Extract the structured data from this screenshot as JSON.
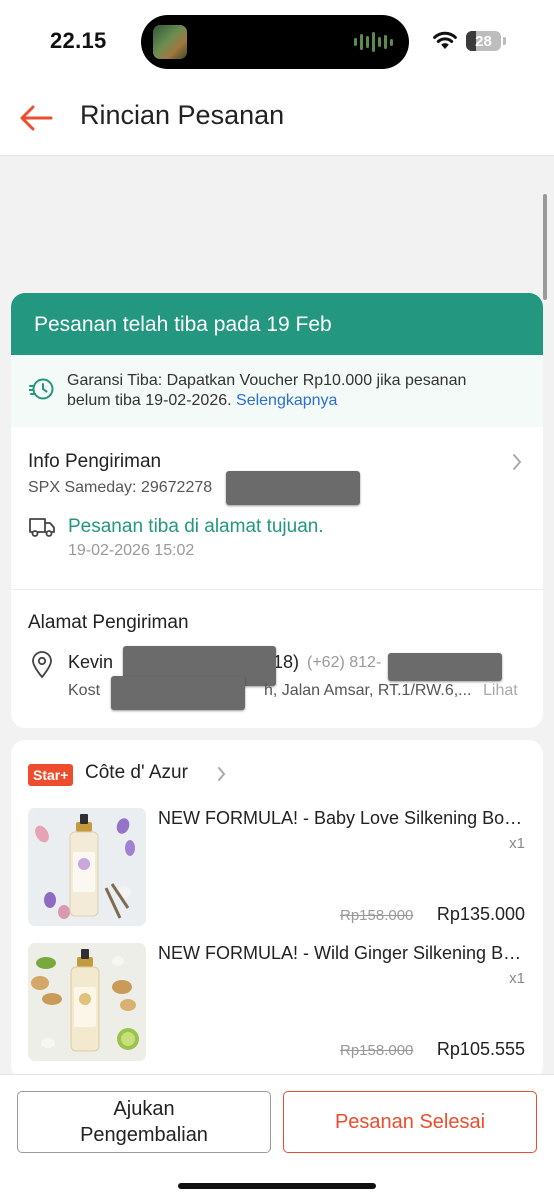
{
  "status_bar": {
    "time": "22.15",
    "battery": "28",
    "battery_percent": 28
  },
  "header": {
    "title": "Rincian Pesanan"
  },
  "order_status": {
    "banner": "Pesanan telah tiba pada 19 Feb"
  },
  "guarantee": {
    "text_line1": "Garansi Tiba: Dapatkan Voucher Rp10.000 jika pesanan",
    "text_line2": "belum tiba 19-02-2026.",
    "link": "Selengkapnya"
  },
  "shipping": {
    "title": "Info Pengiriman",
    "courier": "SPX Sameday: 29672278",
    "status": "Pesanan tiba di alamat tujuan.",
    "timestamp": "19-02-2026 15:02"
  },
  "address": {
    "title": "Alamat Pengiriman",
    "name": "Kevin",
    "name_suffix": "18)",
    "phone": "(+62) 812-",
    "line_prefix": "Kost",
    "line_suffix": "h, Jalan Amsar, RT.1/RW.6,...",
    "more_link": "Lihat"
  },
  "shop": {
    "badge": "Star+",
    "name": "Côte d' Azur",
    "products": [
      {
        "name": "NEW FORMULA! - Baby Love Silkening Body Mist",
        "qty": "x1",
        "old_price": "Rp158.000",
        "price": "Rp135.000"
      },
      {
        "name": "NEW FORMULA! - Wild Ginger Silkening Body Mist",
        "qty": "x1",
        "old_price": "Rp158.000",
        "price": "Rp105.555"
      }
    ]
  },
  "actions": {
    "return_line1": "Ajukan",
    "return_line2": "Pengembalian",
    "complete": "Pesanan Selesai"
  },
  "colors": {
    "brand": "#ee4d2d",
    "success": "#23977f",
    "link": "#2b6fd6"
  },
  "icons": [
    "back-arrow-icon",
    "wifi-icon",
    "battery-icon",
    "clock-guarantee-icon",
    "chevron-right-icon",
    "truck-icon",
    "location-pin-icon"
  ]
}
